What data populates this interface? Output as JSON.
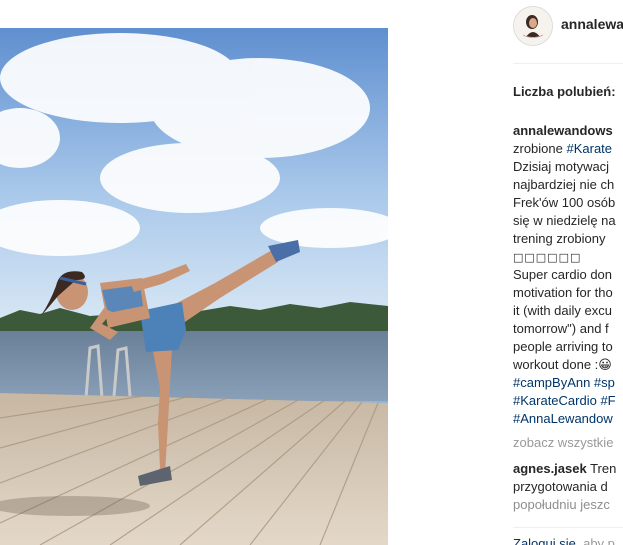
{
  "post": {
    "username": "annalewa",
    "likes_label": "Liczba polubień:",
    "caption_lines": [
      {
        "text": "annalewandows",
        "bold": true
      },
      {
        "text": "zrobione ",
        "tag": "#Karate"
      },
      {
        "text": "Dzisiaj motywacj"
      },
      {
        "text": "najbardziej nie ch"
      },
      {
        "text": "Frek'ów 100 osób"
      },
      {
        "text": "się w niedzielę na"
      },
      {
        "text": "trening zrobiony"
      },
      {
        "text": "□□□□□□",
        "boxes": true
      },
      {
        "text": "Super cardio don"
      },
      {
        "text": "motivation for tho"
      },
      {
        "text": "it (with daily excu"
      },
      {
        "text": "tomorrow\") and f"
      },
      {
        "text": "people arriving to"
      },
      {
        "text": "workout done :😀"
      },
      {
        "tag": "#campByAnn #sp"
      },
      {
        "tag": "#KarateCardio #F"
      },
      {
        "tag": "#AnnaLewandow"
      }
    ],
    "view_all": "zobacz wszystkie",
    "comment": {
      "user": "agnes.jasek",
      "text_lines": [
        {
          "text": "agnes.jasek",
          "rest": " Tren"
        },
        {
          "text": "przygotowania d"
        },
        {
          "text": "popołudniu jeszc"
        }
      ]
    },
    "login_link": "Zaloguj się",
    "login_rest": ", aby p"
  }
}
